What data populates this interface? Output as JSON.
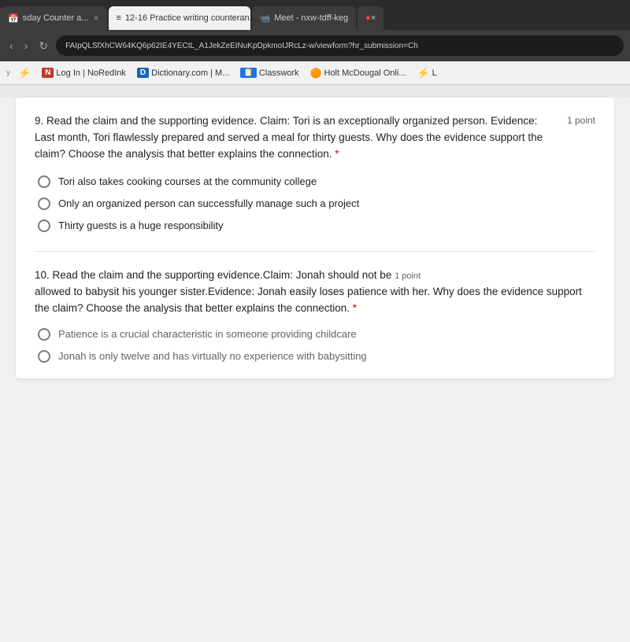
{
  "browser": {
    "tabs": [
      {
        "id": "tab-1",
        "label": "sday Counter a...",
        "icon": "📅",
        "active": false,
        "closable": true
      },
      {
        "id": "tab-2",
        "label": "12-16 Practice writing counteran...",
        "icon": "≡",
        "active": true,
        "closable": true
      },
      {
        "id": "tab-3",
        "label": "Meet - nxw-tdff-keg",
        "icon": "📹",
        "active": false,
        "closable": false
      },
      {
        "id": "tab-4",
        "label": "×",
        "icon": "",
        "active": false,
        "closable": false
      }
    ],
    "address_bar": "FAIpQLSfXhCW64KQ6p62IE4YECtL_A1JekZeEINuKpDpkmoIJRcLz-w/viewform?hr_submission=Ch",
    "bookmarks": [
      {
        "id": "bm-1",
        "label": "⚡",
        "icon": ""
      },
      {
        "id": "bm-2",
        "label": "Log In | NoRedInk",
        "icon": "N"
      },
      {
        "id": "bm-3",
        "label": "Dictionary.com | M...",
        "icon": "D"
      },
      {
        "id": "bm-4",
        "label": "Classwork",
        "icon": "📋"
      },
      {
        "id": "bm-5",
        "label": "Holt McDougal Onli...",
        "icon": "🟠"
      },
      {
        "id": "bm-6",
        "label": "⚡",
        "icon": ""
      }
    ]
  },
  "questions": {
    "q9": {
      "number": "9.",
      "text": "Read the claim and the supporting evidence. Claim: Tori is an exceptionally organized person. Evidence: Last month, Tori flawlessly prepared and served a meal for thirty guests. Why does the evidence support the claim? Choose the analysis that better explains the connection.",
      "required": "*",
      "points": "1 point",
      "options": [
        "Tori also takes cooking courses at the community college",
        "Only an organized person can successfully manage such a project",
        "Thirty guests is a huge responsibility"
      ]
    },
    "q10": {
      "number": "10.",
      "text": "Read the claim and the supporting evidence.Claim: Jonah should not be allowed to babysit his younger sister.Evidence: Jonah easily loses patience with her. Why does the evidence support the claim? Choose the analysis that better explains the connection.",
      "required": "*",
      "points": "1 point",
      "options": [
        "Patience is a crucial characteristic in someone providing childcare",
        "Jonah is only twelve and has virtually no experience with babysitting"
      ]
    }
  }
}
